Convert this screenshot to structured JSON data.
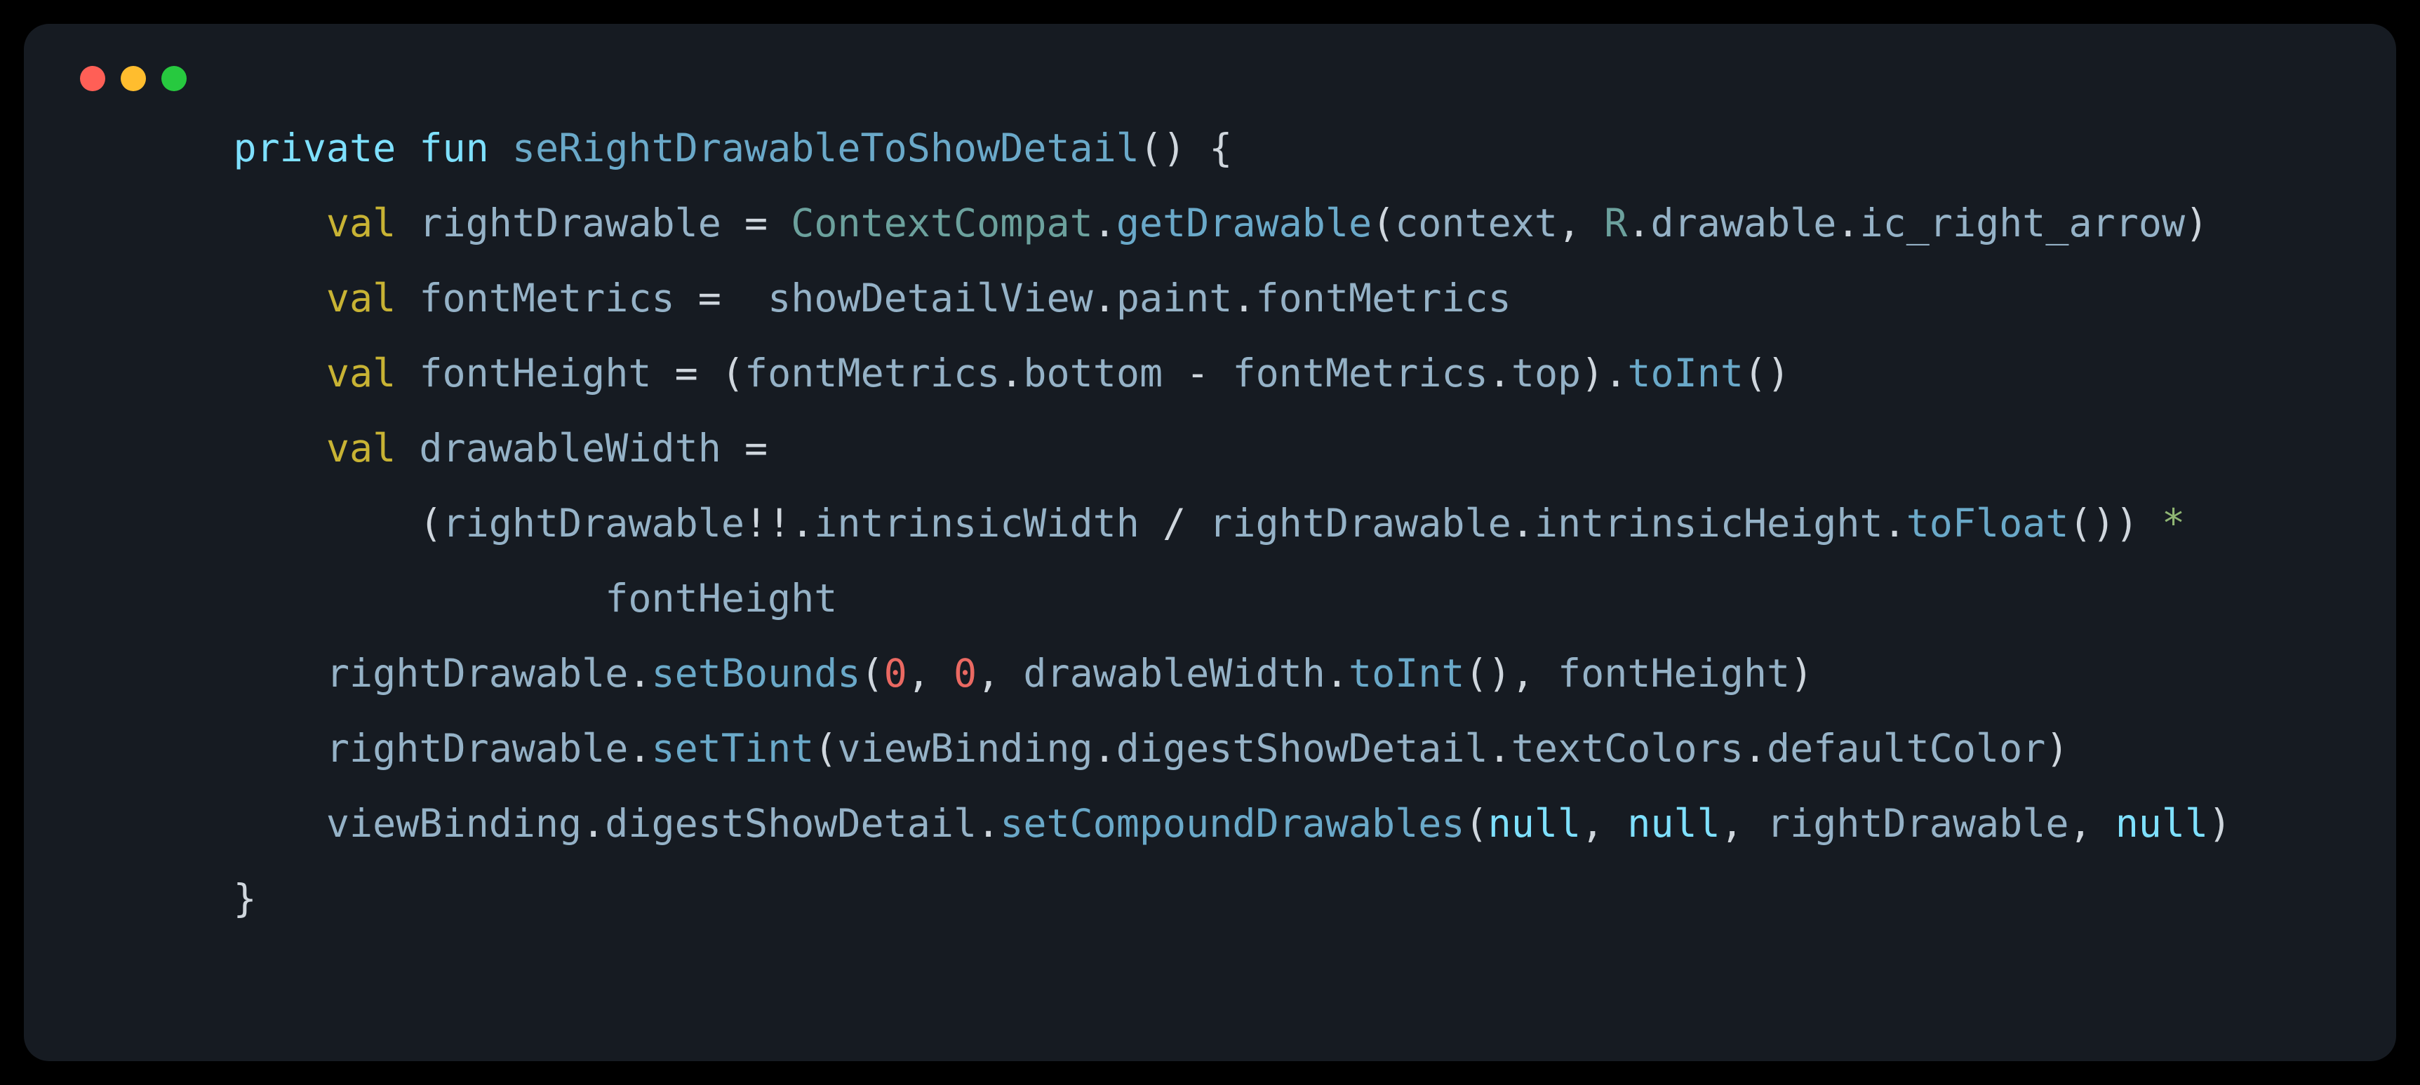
{
  "window": {
    "lights": [
      "close",
      "minimize",
      "zoom"
    ]
  },
  "code": {
    "tokens": [
      [
        [
          "sp",
          "    "
        ],
        [
          "kw",
          "private"
        ],
        [
          "sp",
          " "
        ],
        [
          "kw",
          "fun"
        ],
        [
          "sp",
          " "
        ],
        [
          "fn",
          "seRightDrawableToShowDetail"
        ],
        [
          "p",
          "() {"
        ]
      ],
      [
        [
          "sp",
          "        "
        ],
        [
          "kv",
          "val"
        ],
        [
          "sp",
          " "
        ],
        [
          "id",
          "rightDrawable"
        ],
        [
          "sp",
          " "
        ],
        [
          "p",
          "="
        ],
        [
          "sp",
          " "
        ],
        [
          "ty",
          "ContextCompat"
        ],
        [
          "p",
          "."
        ],
        [
          "fn",
          "getDrawable"
        ],
        [
          "p",
          "("
        ],
        [
          "id",
          "context"
        ],
        [
          "p",
          ", "
        ],
        [
          "ty",
          "R"
        ],
        [
          "p",
          "."
        ],
        [
          "id",
          "drawable"
        ],
        [
          "p",
          "."
        ],
        [
          "id",
          "ic_right_arrow"
        ],
        [
          "p",
          ")"
        ]
      ],
      [
        [
          "sp",
          "        "
        ],
        [
          "kv",
          "val"
        ],
        [
          "sp",
          " "
        ],
        [
          "id",
          "fontMetrics"
        ],
        [
          "sp",
          " "
        ],
        [
          "p",
          "="
        ],
        [
          "sp",
          "  "
        ],
        [
          "id",
          "showDetailView"
        ],
        [
          "p",
          "."
        ],
        [
          "id",
          "paint"
        ],
        [
          "p",
          "."
        ],
        [
          "id",
          "fontMetrics"
        ]
      ],
      [
        [
          "sp",
          "        "
        ],
        [
          "kv",
          "val"
        ],
        [
          "sp",
          " "
        ],
        [
          "id",
          "fontHeight"
        ],
        [
          "sp",
          " "
        ],
        [
          "p",
          "="
        ],
        [
          "sp",
          " "
        ],
        [
          "p",
          "("
        ],
        [
          "id",
          "fontMetrics"
        ],
        [
          "p",
          "."
        ],
        [
          "id",
          "bottom"
        ],
        [
          "sp",
          " "
        ],
        [
          "p",
          "-"
        ],
        [
          "sp",
          " "
        ],
        [
          "id",
          "fontMetrics"
        ],
        [
          "p",
          "."
        ],
        [
          "id",
          "top"
        ],
        [
          "p",
          ")."
        ],
        [
          "fn",
          "toInt"
        ],
        [
          "p",
          "()"
        ]
      ],
      [
        [
          "sp",
          "        "
        ],
        [
          "kv",
          "val"
        ],
        [
          "sp",
          " "
        ],
        [
          "id",
          "drawableWidth"
        ],
        [
          "sp",
          " "
        ],
        [
          "p",
          "="
        ]
      ],
      [
        [
          "sp",
          "            "
        ],
        [
          "p",
          "("
        ],
        [
          "id",
          "rightDrawable"
        ],
        [
          "p",
          "!!."
        ],
        [
          "id",
          "intrinsicWidth"
        ],
        [
          "sp",
          " "
        ],
        [
          "p",
          "/"
        ],
        [
          "sp",
          " "
        ],
        [
          "id",
          "rightDrawable"
        ],
        [
          "p",
          "."
        ],
        [
          "id",
          "intrinsicHeight"
        ],
        [
          "p",
          "."
        ],
        [
          "fn",
          "toFloat"
        ],
        [
          "p",
          "())"
        ],
        [
          "sp",
          " "
        ],
        [
          "op",
          "*"
        ]
      ],
      [
        [
          "sp",
          "                    "
        ],
        [
          "id",
          "fontHeight"
        ]
      ],
      [
        [
          "sp",
          "        "
        ],
        [
          "id",
          "rightDrawable"
        ],
        [
          "p",
          "."
        ],
        [
          "fn",
          "setBounds"
        ],
        [
          "p",
          "("
        ],
        [
          "num",
          "0"
        ],
        [
          "p",
          ", "
        ],
        [
          "num",
          "0"
        ],
        [
          "p",
          ", "
        ],
        [
          "id",
          "drawableWidth"
        ],
        [
          "p",
          "."
        ],
        [
          "fn",
          "toInt"
        ],
        [
          "p",
          "(), "
        ],
        [
          "id",
          "fontHeight"
        ],
        [
          "p",
          ")"
        ]
      ],
      [
        [
          "sp",
          "        "
        ],
        [
          "id",
          "rightDrawable"
        ],
        [
          "p",
          "."
        ],
        [
          "fn",
          "setTint"
        ],
        [
          "p",
          "("
        ],
        [
          "id",
          "viewBinding"
        ],
        [
          "p",
          "."
        ],
        [
          "id",
          "digestShowDetail"
        ],
        [
          "p",
          "."
        ],
        [
          "id",
          "textColors"
        ],
        [
          "p",
          "."
        ],
        [
          "id",
          "defaultColor"
        ],
        [
          "p",
          ")"
        ]
      ],
      [
        [
          "sp",
          "        "
        ],
        [
          "id",
          "viewBinding"
        ],
        [
          "p",
          "."
        ],
        [
          "id",
          "digestShowDetail"
        ],
        [
          "p",
          "."
        ],
        [
          "fn",
          "setCompoundDrawables"
        ],
        [
          "p",
          "("
        ],
        [
          "kw",
          "null"
        ],
        [
          "p",
          ", "
        ],
        [
          "kw",
          "null"
        ],
        [
          "p",
          ", "
        ],
        [
          "id",
          "rightDrawable"
        ],
        [
          "p",
          ", "
        ],
        [
          "kw",
          "null"
        ],
        [
          "p",
          ")"
        ]
      ],
      [
        [
          "sp",
          "    "
        ],
        [
          "p",
          "}"
        ]
      ]
    ]
  }
}
